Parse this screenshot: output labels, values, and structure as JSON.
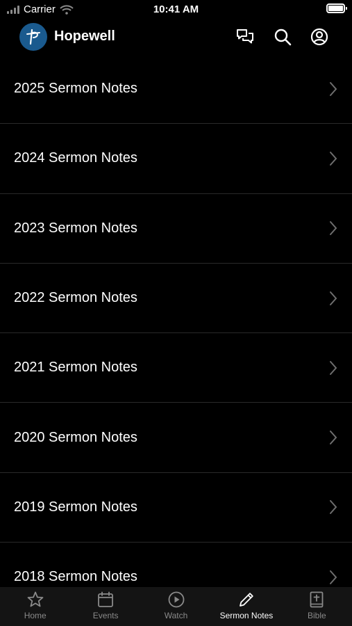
{
  "status_bar": {
    "carrier": "Carrier",
    "time": "10:41 AM"
  },
  "header": {
    "title": "Hopewell",
    "logo_icon": "church-logo-icon",
    "actions": [
      "messages-icon",
      "search-icon",
      "profile-icon"
    ]
  },
  "list": {
    "items": [
      {
        "label": "2025 Sermon Notes"
      },
      {
        "label": "2024 Sermon Notes"
      },
      {
        "label": "2023 Sermon Notes"
      },
      {
        "label": "2022 Sermon Notes"
      },
      {
        "label": "2021 Sermon Notes"
      },
      {
        "label": "2020 Sermon Notes"
      },
      {
        "label": "2019 Sermon Notes"
      },
      {
        "label": "2018 Sermon Notes"
      }
    ]
  },
  "tab_bar": {
    "active": "Sermon Notes",
    "tabs": [
      {
        "label": "Home",
        "icon": "star-icon"
      },
      {
        "label": "Events",
        "icon": "calendar-icon"
      },
      {
        "label": "Watch",
        "icon": "play-circle-icon"
      },
      {
        "label": "Sermon Notes",
        "icon": "pencil-icon"
      },
      {
        "label": "Bible",
        "icon": "bible-icon"
      }
    ]
  },
  "colors": {
    "background": "#000000",
    "divider": "#2a2a2a",
    "inactive": "#8a8a8a",
    "logo": "#1a5a8e",
    "tab_bar": "#141414"
  }
}
